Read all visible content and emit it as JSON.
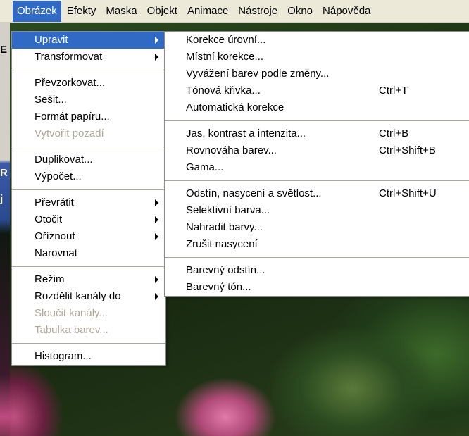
{
  "menubar": {
    "items": [
      "Obrázek",
      "Efekty",
      "Maska",
      "Objekt",
      "Animace",
      "Nástroje",
      "Okno",
      "Nápověda"
    ]
  },
  "image_menu": {
    "items": [
      {
        "label": "Upravit",
        "submenu": true,
        "selected": true
      },
      {
        "label": "Transformovat",
        "submenu": true
      },
      {
        "label": "Převzorkovat..."
      },
      {
        "label": "Sešit..."
      },
      {
        "label": "Formát papíru..."
      },
      {
        "label": "Vytvořit pozadí",
        "disabled": true
      },
      {
        "label": "Duplikovat..."
      },
      {
        "label": "Výpočet..."
      },
      {
        "label": "Převrátit",
        "submenu": true
      },
      {
        "label": "Otočit",
        "submenu": true
      },
      {
        "label": "Oříznout",
        "submenu": true
      },
      {
        "label": "Narovnat"
      },
      {
        "label": "Režim",
        "submenu": true
      },
      {
        "label": "Rozdělit kanály do",
        "submenu": true
      },
      {
        "label": "Sloučit kanály...",
        "disabled": true
      },
      {
        "label": "Tabulka barev...",
        "disabled": true
      },
      {
        "label": "Histogram..."
      }
    ]
  },
  "adjust_menu": {
    "items": [
      {
        "label": "Korekce úrovní..."
      },
      {
        "label": "Místní korekce..."
      },
      {
        "label": "Vyvážení barev podle změny..."
      },
      {
        "label": "Tónová křivka...",
        "shortcut": "Ctrl+T"
      },
      {
        "label": "Automatická korekce"
      },
      {
        "label": "Jas, kontrast a intenzita...",
        "shortcut": "Ctrl+B"
      },
      {
        "label": "Rovnováha barev...",
        "shortcut": "Ctrl+Shift+B"
      },
      {
        "label": "Gama..."
      },
      {
        "label": "Odstín, nasycení a světlost...",
        "shortcut": "Ctrl+Shift+U"
      },
      {
        "label": "Selektivní barva..."
      },
      {
        "label": "Nahradit barvy..."
      },
      {
        "label": "Zrušit nasycení"
      },
      {
        "label": "Barevný odstín..."
      },
      {
        "label": "Barevný tón..."
      }
    ]
  },
  "side_letters": [
    "E",
    "R",
    "j"
  ],
  "colors": {
    "highlight": "#316ac5",
    "menu_bg": "#ffffff",
    "bar_bg": "#ece9d8",
    "disabled": "#aca899"
  }
}
